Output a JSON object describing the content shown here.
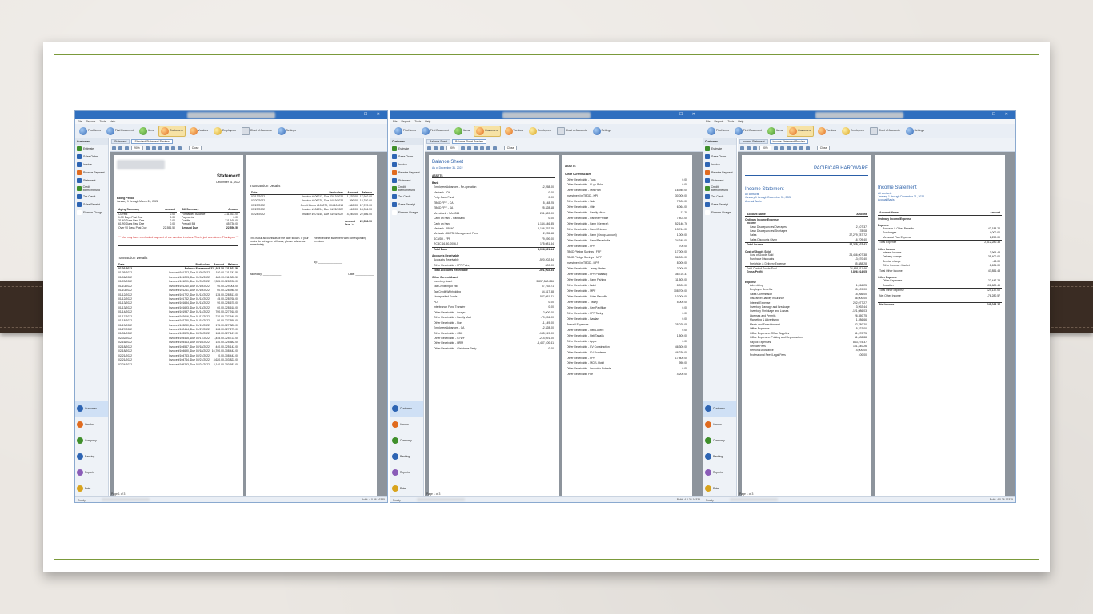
{
  "app": {
    "window_controls": "– ☐ ✕",
    "menu": [
      "File",
      "Reports",
      "Tools",
      "Help"
    ],
    "toolbar": [
      {
        "label": "Find Items",
        "icon": "find-items-icon"
      },
      {
        "label": "Find Document",
        "icon": "find-document-icon"
      },
      {
        "label": "Items",
        "icon": "items-icon"
      },
      {
        "label": "Customers",
        "icon": "customers-icon"
      },
      {
        "label": "Vendors",
        "icon": "vendors-icon"
      },
      {
        "label": "Employees",
        "icon": "employees-icon"
      },
      {
        "label": "Chart of Accounts",
        "icon": "chart-accounts-icon"
      },
      {
        "label": "Settings",
        "icon": "settings-icon"
      }
    ],
    "sidebar_title": "Customer",
    "sidebar_items": [
      "Estimate",
      "Sales Order",
      "Invoice",
      "Receive Payment",
      "Statement",
      "Credit Memo/Refund",
      "Tax Credit",
      "Sales Receipt",
      "Finance Charge"
    ],
    "modules": [
      "Customer",
      "Vendor",
      "Company",
      "Banking",
      "Reports",
      "Data"
    ],
    "print_toolbar": {
      "zoom": "90%",
      "close": "Close"
    },
    "page_label": "Page 1 of 3",
    "status_left": "Ready",
    "status_right": "Build: 4.0.36.16335"
  },
  "windows": [
    {
      "tab_list": "Statement",
      "tab_preview": "Standard Statement Preview",
      "statement": {
        "title": "Statement",
        "date": "December 31, 2022",
        "billing_period_label": "Billing Period",
        "billing_period": "January 1 through March 24, 2022",
        "aging_head": [
          "Aging Summary",
          "Amount"
        ],
        "aging": [
          [
            "Current",
            "0.00"
          ],
          [
            "1-30 Days Past Due",
            "0.00"
          ],
          [
            "31-60 Days Past Due",
            "0.00"
          ],
          [
            "61-90 Days Past Due",
            "0.00"
          ],
          [
            "Over 90 Days Past Due",
            "22,556.50"
          ]
        ],
        "bill_head": [
          "Bill Summary",
          "Amount"
        ],
        "bill": [
          [
            "Forwarded Balance",
            "-311,923.00"
          ],
          [
            "Payments",
            "0.00"
          ],
          [
            "Credits",
            "-311,165.00"
          ],
          [
            "Prepaid Bill",
            "45,730.00"
          ],
          [
            "Amount Due",
            "22,556.50"
          ]
        ],
        "reminder": "*** You may have overlooked payment of our overdue invoices. This is just a reminder. Thank you ***",
        "td_title": "Transaction Details",
        "td_head": [
          "Date",
          "Particulars",
          "Amount",
          "Balance"
        ],
        "td": [
          [
            "01/01/2022",
            "Balance Forwarded",
            "-311,923.50",
            "-311,923.50"
          ],
          [
            "01/05/2022",
            "Invoice #101202, Due 01/05/2022",
            "180.00",
            "-311,743.50"
          ],
          [
            "01/06/2022",
            "Invoice #101203, Due 01/06/2022",
            "660.00",
            "-311,083.50"
          ],
          [
            "01/09/2022",
            "Invoice #101201, Due 01/09/2022",
            "2,985.00",
            "-328,098.00"
          ],
          [
            "01/10/2022",
            "Invoice #101240, Due 01/10/2022",
            "90.00",
            "-329,008.00"
          ],
          [
            "01/10/2022",
            "Invoice #101241, Due 01/10/2022",
            "60.00",
            "-328,948.00"
          ],
          [
            "01/12/2022",
            "Invoice #101722, Due 01/12/2022",
            "135.00",
            "-328,813.00"
          ],
          [
            "01/12/2022",
            "Invoice #101742, Due 01/12/2022",
            "45.00",
            "-328,768.00"
          ],
          [
            "01/13/2022",
            "Invoice #101684, Due 01/13/2022",
            "90.00",
            "-328,678.00"
          ],
          [
            "01/13/2022",
            "Invoice #101693, Due 01/13/2022",
            "60.00",
            "-328,618.00"
          ],
          [
            "01/14/2022",
            "Invoice #101937, Due 01/14/2022",
            "700.00",
            "-327,918.00"
          ],
          [
            "01/17/2022",
            "Invoice #102616, Due 01/17/2022",
            "270.00",
            "-327,648.00"
          ],
          [
            "01/18/2022",
            "Invoice #102780, Due 01/18/2022",
            "90.00",
            "-327,558.00"
          ],
          [
            "01/19/2022",
            "Invoice #103230, Due 01/19/2022",
            "175.00",
            "-327,383.00"
          ],
          [
            "01/27/2022",
            "Invoice #102414, Due 01/27/2022",
            "108.00",
            "-327,275.00"
          ],
          [
            "01/31/2022",
            "Invoice #103525, Due 02/02/2022",
            "108.00",
            "-327,167.00"
          ],
          [
            "02/02/2022",
            "Invoice #104415, Due 02/17/2022",
            "1,445.00",
            "-325,722.00"
          ],
          [
            "02/16/2022",
            "Invoice #104413, Due 02/16/2022",
            "140.00",
            "-325,582.00"
          ],
          [
            "02/18/2022",
            "Invoice #104547, Due 02/18/2022",
            "440.00",
            "-325,142.00"
          ],
          [
            "02/18/2022",
            "Invoice #104690, Due 02/18/2022",
            "16,700.00",
            "-308,442.00"
          ],
          [
            "02/21/2022",
            "Invoice #104743, Due 02/21/2022",
            "0.00",
            "-308,442.00"
          ],
          [
            "02/21/2022",
            "Invoice #104744, Due 02/21/2022",
            "4,620.00",
            "-303,822.00"
          ],
          [
            "02/24/2022",
            "Invoice #105293, Due 02/24/2022",
            "3,140.00",
            "-300,682.00"
          ]
        ],
        "td2_title": "Transaction Details",
        "td2": [
          [
            "03/13/2022",
            "Invoice #106013, Due 03/13/2022",
            "1,270.00",
            "17,940.00"
          ],
          [
            "03/20/2022",
            "Invoice #106070, Due 04/19/2022",
            "390.00",
            "18,330.00"
          ],
          [
            "03/20/2022",
            "Credit Memo #106070, 004 106013",
            "-360.00",
            "17,970.00"
          ],
          [
            "03/23/2022",
            "Invoice #106094, Due 04/22/2022",
            "440.00",
            "18,316.50"
          ],
          [
            "03/24/2022",
            "Invoice #107140, Due 03/23/2022",
            "4,240.00",
            "22,556.50"
          ]
        ],
        "amount_due_label": "Amount Due ->",
        "amount_due": "22,556.50",
        "note_left": "This is our accounts as of the date shown. If your books do not agree will ours, please advise us immediately.",
        "note_right": "Received this statement with corresponding invoices",
        "by_label": "By:",
        "issued_label": "Issued By:",
        "date_label": "Date:"
      }
    },
    {
      "tab_list": "Balance Sheet",
      "tab_preview": "Balance Sheet Preview",
      "bs": {
        "title": "Balance Sheet",
        "subtitle": "As of December 31, 2022",
        "assets_label": "ASSETS",
        "bank_label": "Bank",
        "bank": [
          [
            "Employee Advances - Re-operation",
            "12,258.00"
          ],
          [
            "Metbank - Cit",
            "0.00"
          ],
          [
            "Petty Cash Fund",
            "0.00"
          ],
          [
            "TBGD FPF - CA",
            "5,148.25"
          ],
          [
            "TBGD FPF - SA",
            "25,328.18"
          ],
          [
            "Metrobank - SA-8314",
            "281,320.00"
          ],
          [
            "Cash on hand - Pan Bank",
            "0.00"
          ],
          [
            "Cash on hand",
            "1,144,446.35"
          ],
          [
            "Metbank - 89440",
            "-6,106,797.25"
          ],
          [
            "Metbank - 86.735 Management Fund",
            "2,235.68"
          ],
          [
            "SCASH - FPF",
            "79,490.00"
          ],
          [
            "RCBC 16-50-0006-5",
            "175,081.44"
          ]
        ],
        "total_bank": [
          "Total Bank",
          "3,096,521.14"
        ],
        "ar_label": "Accounts Receivable",
        "ar": [
          [
            "Accounts Receivable",
            "-520,202.84"
          ],
          [
            "Other Receivable - FPF Petrey",
            "800.00"
          ]
        ],
        "total_ar": [
          "Total Accounts Receivable",
          "-521,002.84"
        ],
        "oca_label": "Other Current Asset",
        "oca": [
          [
            "Inventory Asset",
            "3,837,580.886"
          ],
          [
            "Tax Credit Input Vat",
            "37,792.71"
          ],
          [
            "Tax Credit Withholding",
            "64,317.58"
          ],
          [
            "Undeposited Funds",
            "-537,051.21"
          ],
          [
            "PDI",
            "0.00"
          ],
          [
            "Interbranch Fund Transfer",
            "0.00"
          ],
          [
            "Other Receivable - Analyn",
            "2,000.00"
          ],
          [
            "Other Receivable - Family Mart",
            "-79,096.00"
          ],
          [
            "Other Receivable - Roni",
            "-1,149.00"
          ],
          [
            "Employee Advances - CA",
            "-2,328.00"
          ],
          [
            "Other Receivable - CBC",
            "-145,919.00"
          ],
          [
            "Other Receivable - CI WF",
            "-214,691.00"
          ],
          [
            "Other Receivable - HRM",
            "-6,487,100.41"
          ],
          [
            "Other Receivable - Christmas Party",
            "0.00"
          ]
        ],
        "col2_assets": "ASSETS",
        "col2_oca": "Other Current Asset",
        "col2": [
          [
            "Other Receivable - Tugs",
            "0.00"
          ],
          [
            "Other Receivable - Ki-yo-Bola",
            "0.00"
          ],
          [
            "Other Receivable - Mini Hari",
            "16,940.00"
          ],
          [
            "Investment in TBGD - KPI",
            "30,000.00"
          ],
          [
            "Other Receivable - Salo",
            "7,000.00"
          ],
          [
            "Other Receivable - Otin",
            "6,064.00"
          ],
          [
            "Other Receivable - Family Hirao",
            "12.20"
          ],
          [
            "Other Receivable - Parcels/Phrase",
            "7,403.00"
          ],
          [
            "Other Receivable - Farm (General)",
            "52,146.76"
          ],
          [
            "Other Receivable - Farm/Chicken",
            "13,744.00"
          ],
          [
            "Other Receivable - Farm (Group Account)",
            "1,000.00"
          ],
          [
            "Other Receivable - Farm/Paraphalia",
            "24,349.00"
          ],
          [
            "Other Receivable - FPF",
            "700.00"
          ],
          [
            "TBGD Pledge Savings - FPF",
            "17,000.00"
          ],
          [
            "TBGD Pledge Savings - MPF",
            "36,000.00"
          ],
          [
            "Investment in TBGD - MPF",
            "8,000.00"
          ],
          [
            "Other Receivable - Jenny Umlas",
            "3,000.00"
          ],
          [
            "Other Receivable - FPF Padaraog",
            "36,725.31"
          ],
          [
            "Other Receivable - Farm Fishing",
            "11,505.00"
          ],
          [
            "Other Receivable - Baldi",
            "8,000.00"
          ],
          [
            "Other Receivable - MPF",
            "108,700.00"
          ],
          [
            "Other Receivable - Eden Pasudlis",
            "10,000.00"
          ],
          [
            "Other Receivable - Tissey",
            "5,000.00"
          ],
          [
            "Other Receivable - Ken Pacifikar",
            "0.00"
          ],
          [
            "Other Receivable - FPF Tacky",
            "0.00"
          ],
          [
            "Other Receivable - Basilan",
            "0.00"
          ],
          [
            "Prepaid Expenses",
            "25,029.09"
          ],
          [
            "Other Receivable - Reli Lucero",
            "0.00"
          ],
          [
            "Other Receivable - Reli Tagaila",
            "1,500.00"
          ],
          [
            "Other Receivable - Apple",
            "0.00"
          ],
          [
            "Other Receivable - EV Construction",
            "46,300.00"
          ],
          [
            "Other Receivable - EV Pondenm",
            "46,230.00"
          ],
          [
            "Other Receivable - FPF",
            "17,800.00"
          ],
          [
            "Other Receivable - MCFL Hotel",
            "950.00"
          ],
          [
            "Other Receivable - Leopoldo Estrade",
            "0.00"
          ],
          [
            "Other Receivable Fee",
            "4,200.00"
          ]
        ]
      }
    },
    {
      "tab_list": "Income Statement",
      "tab_preview": "Income Statement Preview",
      "is": {
        "company": "PACIFICAR HARDWARE",
        "title": "Income Statement",
        "scope": "All contacts",
        "period": "January 1 through December 31, 2022",
        "basis": "Accrual Basis",
        "head": [
          "Account Name",
          "Amount"
        ],
        "ordinary": "Ordinary Income/Expense",
        "income_label": "Income",
        "income": [
          [
            "Cash Discrepancies/Overages",
            "2,107.37"
          ],
          [
            "Cash Discrepancies/Shortages",
            "-78.08"
          ],
          [
            "Sales",
            "27,279,787.72"
          ],
          [
            "Sales Discounts Given",
            "-6,709.40"
          ]
        ],
        "total_income": [
          "Total Income",
          "27,275,107.41"
        ],
        "cogs_label": "Cost of Goods Sold",
        "cogs": [
          [
            "Cost of Goods Sold",
            "24,466,007.38"
          ],
          [
            "Purchase Discounts",
            "-3,670.40"
          ],
          [
            "Freight-in & Delivery Expense",
            "35,888.28"
          ]
        ],
        "total_cogs": [
          "Total Cost of Goods Sold",
          "24,498,111.46"
        ],
        "gross": [
          "Gross Profit",
          "2,826,914.05"
        ],
        "exp_label": "Expense",
        "exp": [
          [
            "Advertising",
            "1,266.25"
          ],
          [
            "Employee Benefits",
            "95,109.00"
          ],
          [
            "Sales Commission",
            "15,266.00"
          ],
          [
            "Insurance/Liability Insurance",
            "46,000.00"
          ],
          [
            "Interest Expense",
            "202,077.27"
          ],
          [
            "Inventory Damage and Breakage",
            "3,992.44"
          ],
          [
            "Inventory Shrinkage and Losses",
            "-121,086.03"
          ],
          [
            "Licenses and Permits",
            "26,350.75"
          ],
          [
            "Marketing & Advertising",
            "1,286.66"
          ],
          [
            "Meals and Entertainment",
            "32,780.20"
          ],
          [
            "Office Expenses",
            "5,322.00"
          ],
          [
            "Office Expenses: Office Supplies",
            "11,670.75"
          ],
          [
            "Office Expenses: Printing and Reproduction",
            "11,608.88"
          ],
          [
            "Payroll Expenses",
            "843,275.37"
          ],
          [
            "Service Fees",
            "151,440.26"
          ],
          [
            "Personal Allowance",
            "4,000.00"
          ],
          [
            "Professional Fees/Legal Fees",
            "100.00"
          ]
        ],
        "r_title": "Income Statement",
        "r_scope": "All contacts",
        "r_period": "January 1 through December 31, 2022",
        "r_basis": "Accrual Basis",
        "r_head": [
          "Account Name",
          "Amount"
        ],
        "r_ordinary": "Ordinary Income/Expense",
        "r_exp_label": "Expense",
        "r_exp": [
          [
            "Bonuses & Other Benefits",
            "42,188.22"
          ],
          [
            "Surcharges",
            "4,000.00"
          ],
          [
            "Memorial Plan Expense",
            "1,250.00"
          ]
        ],
        "r_total_exp": [
          "Total Expense",
          "2,512,280.33"
        ],
        "r_oi_label": "Other Income",
        "r_oi": [
          [
            "Interest Income",
            "3,965.43"
          ],
          [
            "Delivery charge",
            "35,400.00"
          ],
          [
            "Service charge",
            "-43.00"
          ],
          [
            "Other Income - Market",
            "8,634.00"
          ]
        ],
        "r_total_oi": [
          "Total Other Income",
          "47,856.43"
        ],
        "r_oe_label": "Other Expense",
        "r_oe": [
          [
            "Other Expenses",
            "22,447.23"
          ],
          [
            "Donation",
            "101,689.46"
          ]
        ],
        "r_total_oe": [
          "Total Other Expense",
          "124,137.00"
        ],
        "r_noi": [
          "Net Other Income",
          "-76,280.57"
        ],
        "r_ni": [
          "Net Income",
          "745,038.27"
        ]
      }
    }
  ]
}
